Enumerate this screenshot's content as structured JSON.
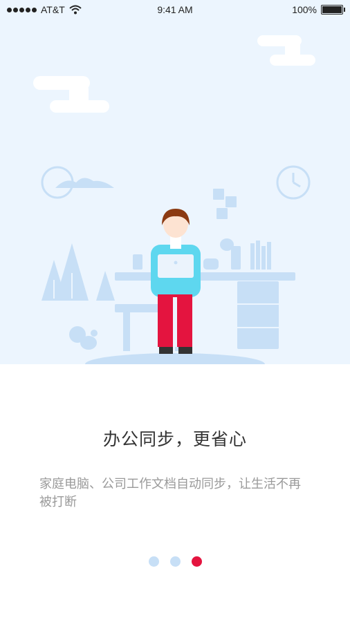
{
  "status_bar": {
    "carrier": "AT&T",
    "time": "9:41 AM",
    "battery": "100%"
  },
  "onboarding": {
    "title": "办公同步，更省心",
    "description": "家庭电脑、公司工作文档自动同步，让生活不再被打断",
    "page_indicator": {
      "total": 3,
      "active_index": 2
    }
  },
  "colors": {
    "hero_background": "#ecf5fe",
    "accent_active_dot": "#e4143f",
    "inactive_dot": "#c7dff6",
    "illustration_light_blue": "#cfe3f8"
  }
}
